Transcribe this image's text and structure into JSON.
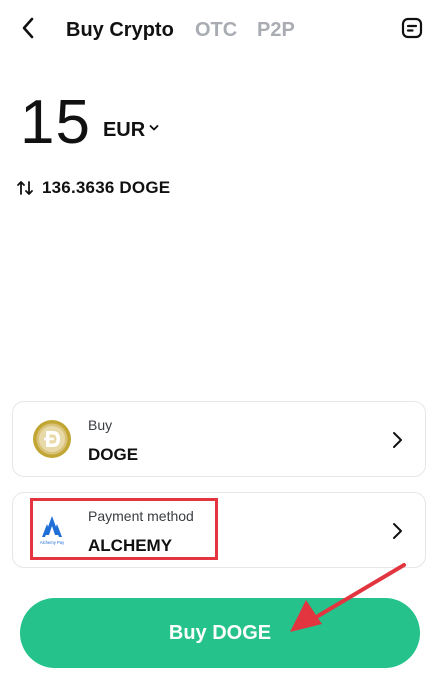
{
  "header": {
    "back_icon": "chevron-left-icon",
    "tabs": [
      {
        "label": "Buy Crypto",
        "active": true
      },
      {
        "label": "OTC",
        "active": false
      },
      {
        "label": "P2P",
        "active": false
      }
    ],
    "orders_icon": "document-icon"
  },
  "amount": {
    "value": "15",
    "currency": "EUR",
    "currency_chevron_icon": "chevron-down-icon"
  },
  "conversion": {
    "swap_icon": "swap-vertical-icon",
    "text": "136.3636 DOGE"
  },
  "buy_card": {
    "label": "Buy",
    "value": "DOGE",
    "icon": "dogecoin-icon"
  },
  "payment_card": {
    "label": "Payment method",
    "value": "ALCHEMY",
    "icon": "alchemy-pay-logo",
    "logo_caption": "Alchemy Pay"
  },
  "action": {
    "label": "Buy DOGE"
  },
  "colors": {
    "primary_button": "#25c28b",
    "annotation_red": "#e2353f",
    "inactive_tab": "#a9adb3"
  }
}
